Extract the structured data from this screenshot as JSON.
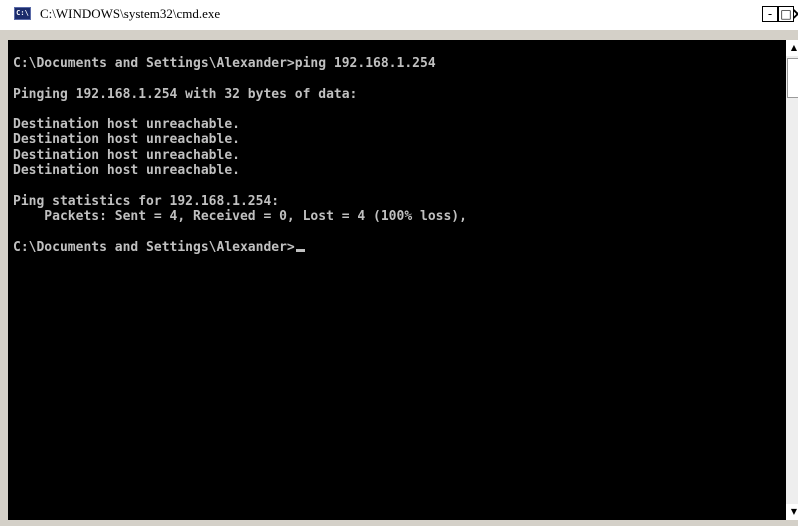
{
  "window": {
    "title": "C:\\WINDOWS\\system32\\cmd.exe",
    "icon": "cmd-app-icon",
    "controls": {
      "minimize": "-",
      "maximize": "□",
      "close": "×"
    }
  },
  "console": {
    "lines": [
      "C:\\Documents and Settings\\Alexander>ping 192.168.1.254",
      "",
      "Pinging 192.168.1.254 with 32 bytes of data:",
      "",
      "Destination host unreachable.",
      "Destination host unreachable.",
      "Destination host unreachable.",
      "Destination host unreachable.",
      "",
      "Ping statistics for 192.168.1.254:",
      "    Packets: Sent = 4, Received = 0, Lost = 4 (100% loss),",
      ""
    ],
    "prompt": "C:\\Documents and Settings\\Alexander>",
    "colors": {
      "background": "#000000",
      "foreground": "#c0c0c0"
    }
  },
  "scrollbar": {
    "up_arrow": "▲",
    "down_arrow": "▼"
  }
}
